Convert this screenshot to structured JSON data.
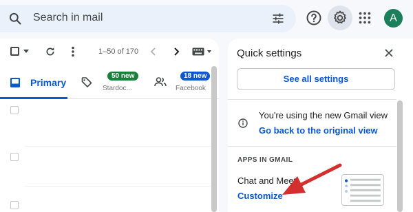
{
  "header": {
    "search_placeholder": "Search in mail",
    "avatar_letter": "A"
  },
  "toolbar": {
    "page_count": "1–50 of 170"
  },
  "tabs": [
    {
      "label": "Primary"
    },
    {
      "badge": "50 new",
      "sub": "Stardoc..."
    },
    {
      "badge": "18 new",
      "sub": "Facebook"
    }
  ],
  "quick_settings": {
    "title": "Quick settings",
    "see_all": "See all settings",
    "view_text": "You're using the new Gmail view",
    "view_link": "Go back to the original view",
    "apps_heading": "APPS IN GMAIL",
    "chat_label": "Chat and Meet",
    "customize_link": "Customize"
  },
  "colors": {
    "accent": "#0b57d0",
    "badge_green": "#188038",
    "annotation_arrow": "#d32f2f",
    "avatar": "#1a7f5a"
  }
}
